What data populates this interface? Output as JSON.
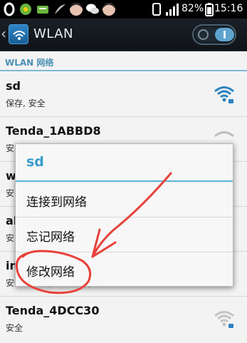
{
  "status_bar": {
    "battery": "82%",
    "time": "15:16"
  },
  "action_bar": {
    "title": "WLAN"
  },
  "list": {
    "section_header": "WLAN 网络",
    "networks": [
      {
        "ssid": "sd",
        "security": "保存, 安全"
      },
      {
        "ssid": "Tenda_1ABBD8",
        "security": "安"
      },
      {
        "ssid": "w",
        "security": "安"
      },
      {
        "ssid": "al",
        "security": "安"
      },
      {
        "ssid": "in",
        "security": "安全（受保护的可用网络）"
      },
      {
        "ssid": "Tenda_4DCC30",
        "security": "安全"
      }
    ]
  },
  "dialog": {
    "title": "sd",
    "items": [
      "连接到网络",
      "忘记网络",
      "修改网络"
    ]
  },
  "colors": {
    "accent": "#3a9bcb",
    "annotation": "#e8413a"
  }
}
